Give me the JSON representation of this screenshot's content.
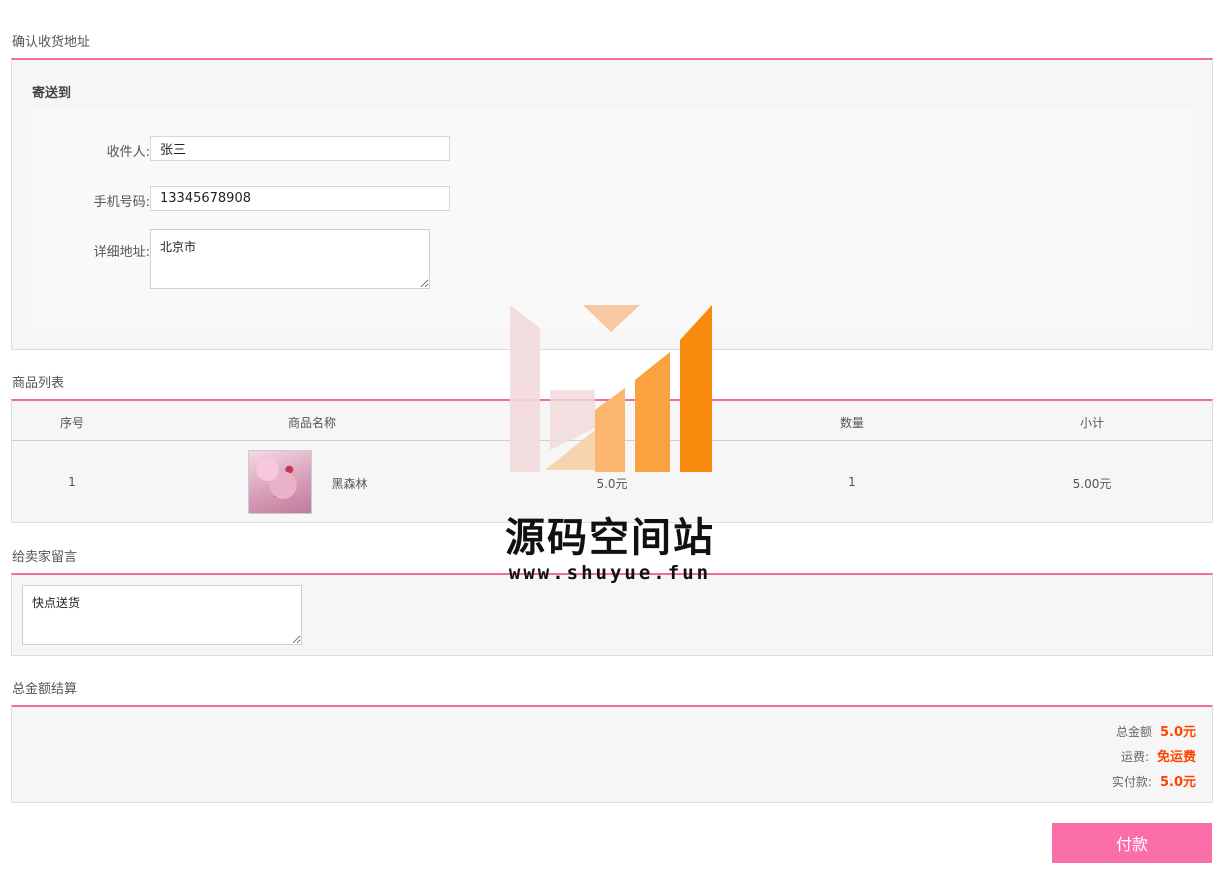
{
  "address": {
    "section_title": "确认收货地址",
    "heading": "寄送到",
    "recipient_label": "收件人:",
    "recipient_value": "张三",
    "phone_label": "手机号码:",
    "phone_value": "13345678908",
    "detail_label": "详细地址:",
    "detail_value": "北京市"
  },
  "goods": {
    "section_title": "商品列表",
    "columns": [
      "序号",
      "商品名称",
      "数量",
      "小计"
    ],
    "rows": [
      {
        "index": "1",
        "name": "黑森林",
        "price": "5.0元",
        "quantity": "1",
        "subtotal": "5.00元"
      }
    ]
  },
  "message": {
    "section_title": "给卖家留言",
    "value": "快点送货"
  },
  "totals": {
    "section_title": "总金额结算",
    "total_label": "总金额",
    "total_value": "5.0元",
    "shipping_label": "运费:",
    "shipping_value": "免运费",
    "paid_label": "实付款:",
    "paid_value": "5.0元"
  },
  "pay_button": "付款",
  "watermark": {
    "title": "源码空间站",
    "url": "www.shuyue.fun"
  },
  "colors": {
    "accent": "#f06ba8",
    "price": "#ff4400",
    "button": "#fb6fa8"
  }
}
